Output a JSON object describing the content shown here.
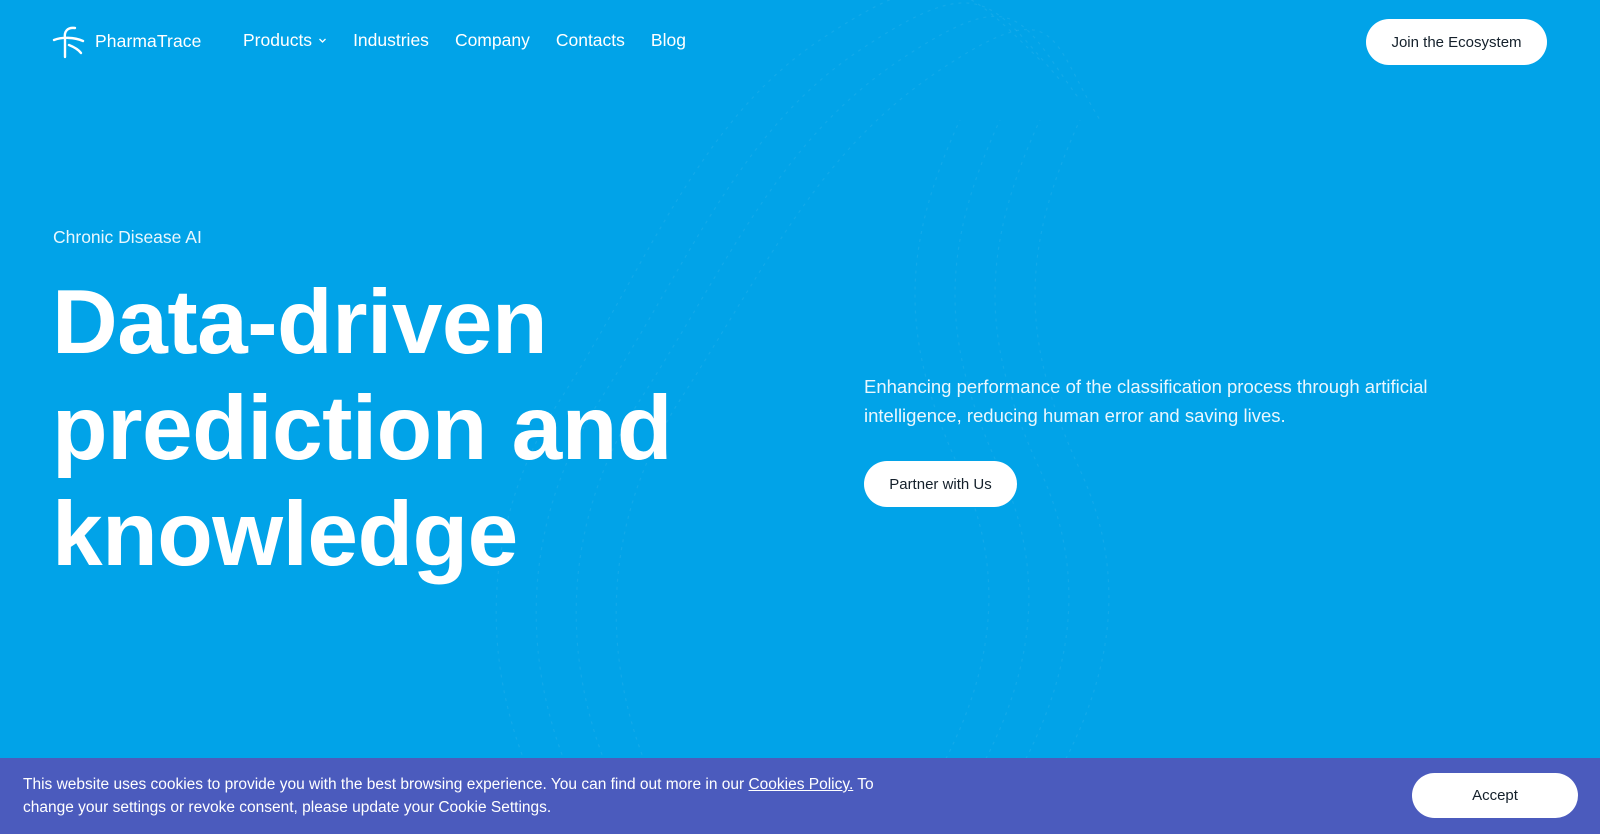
{
  "brand": {
    "name": "PharmaTrace",
    "logo_icon": "pharmatrace-logo-icon"
  },
  "nav": {
    "items": [
      {
        "label": "Products",
        "has_dropdown": true,
        "dropdown_icon": "chevron-down-icon"
      },
      {
        "label": "Industries"
      },
      {
        "label": "Company"
      },
      {
        "label": "Contacts"
      },
      {
        "label": "Blog"
      }
    ],
    "cta_label": "Join the Ecosystem"
  },
  "hero": {
    "eyebrow": "Chronic Disease AI",
    "headline": "Data-driven prediction and knowledge",
    "description": "Enhancing performance of the classification process through artificial intelligence, reducing human error and saving lives.",
    "cta_label": "Partner with Us"
  },
  "cookie_banner": {
    "text_before": "This website uses cookies to provide you with the best browsing experience. You can find out more in our ",
    "link_label": "Cookies Policy.",
    "text_after": " To change your settings or revoke consent, please update your Cookie Settings.",
    "accept_label": "Accept"
  },
  "colors": {
    "background": "#01a3e8",
    "cookie_bar": "#4b5bbd",
    "button_bg": "#ffffff",
    "button_text": "#14202b"
  }
}
